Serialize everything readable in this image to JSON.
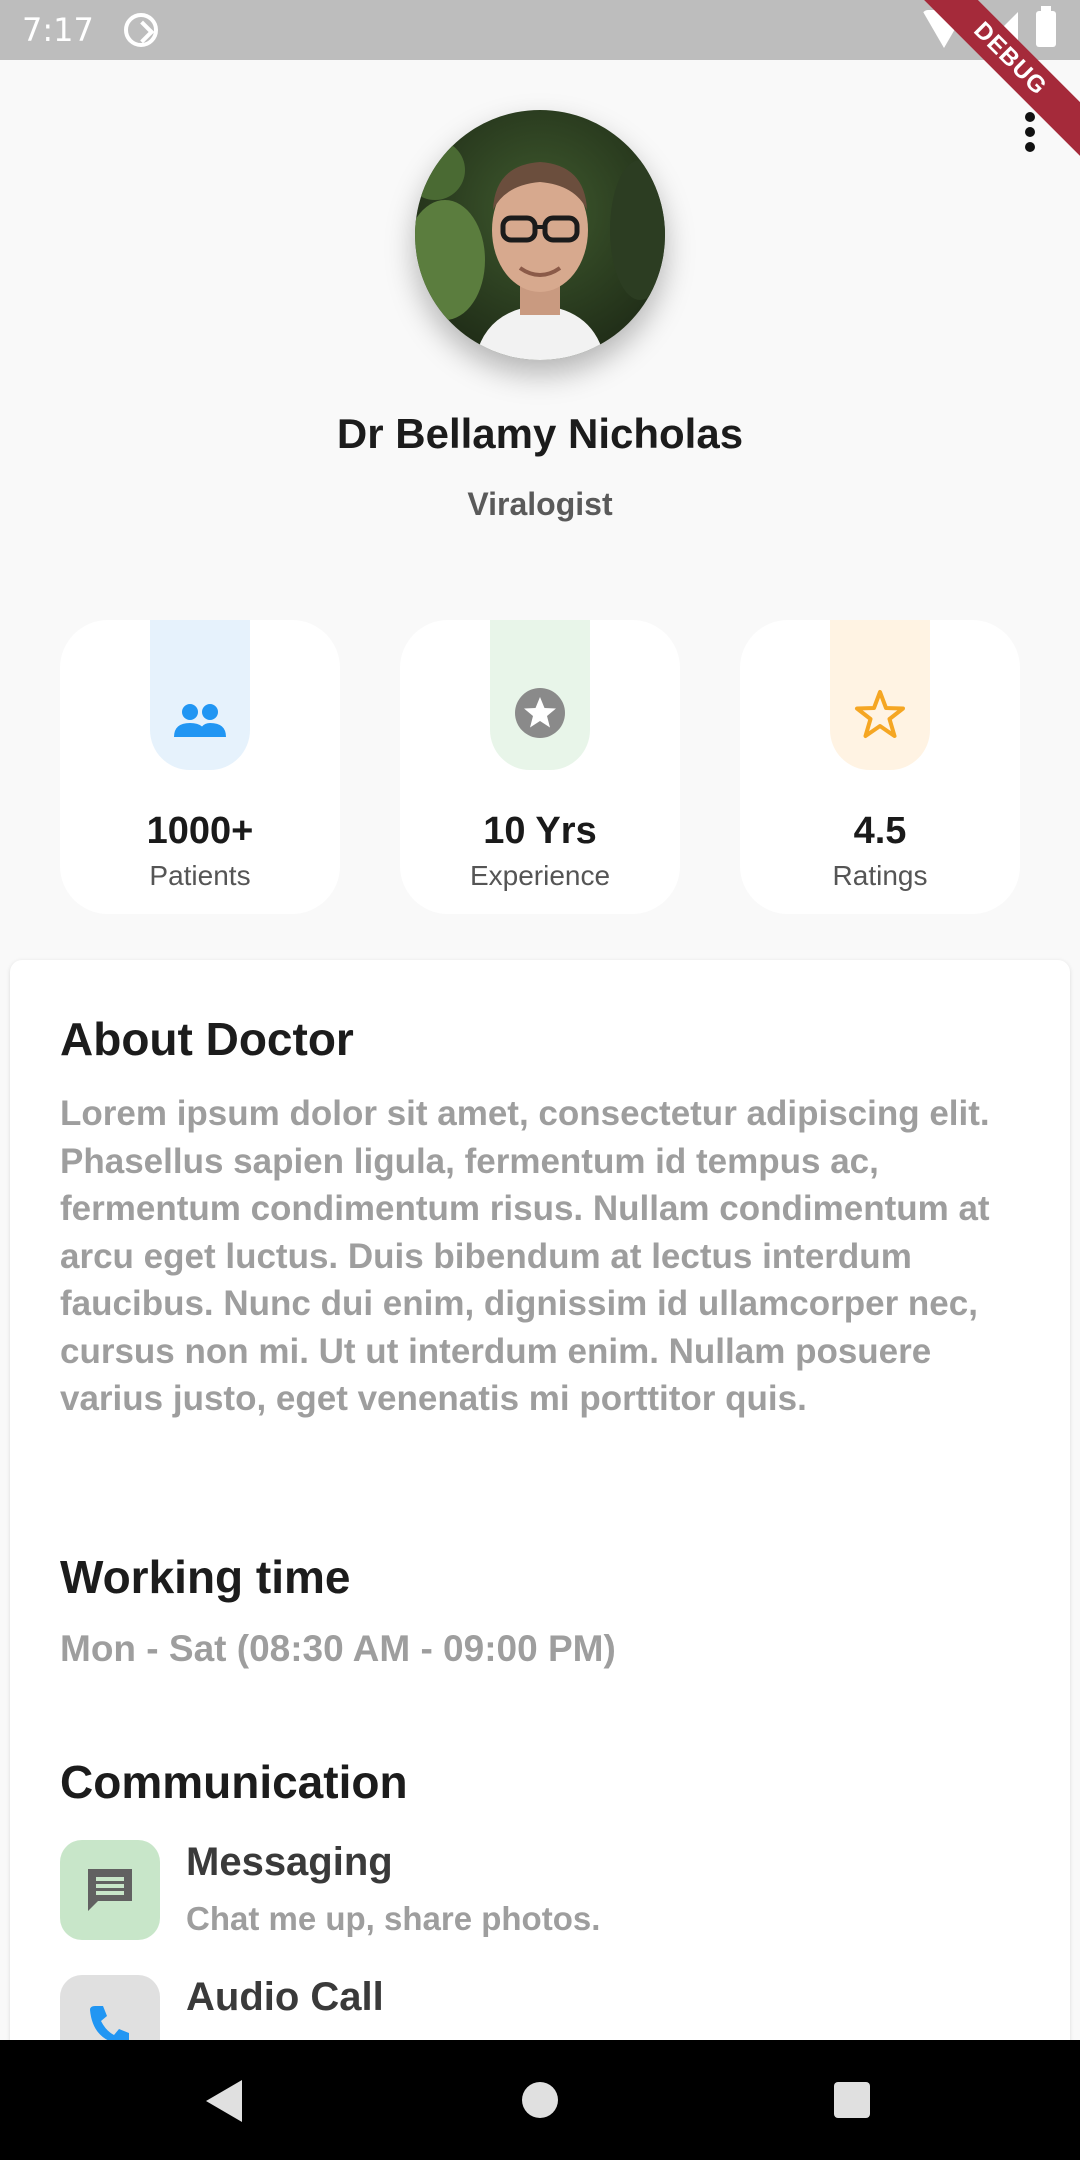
{
  "status_bar": {
    "time": "7:17"
  },
  "debug_label": "DEBUG",
  "doctor": {
    "name": "Dr Bellamy Nicholas",
    "specialty": "Viralogist"
  },
  "stats": [
    {
      "value": "1000+",
      "label": "Patients",
      "icon": "group-icon",
      "tab_color": "#e6f2fc",
      "icon_color": "#2196f3"
    },
    {
      "value": "10 Yrs",
      "label": "Experience",
      "icon": "star-badge-icon",
      "tab_color": "#e8f5e9",
      "icon_color": "#8a8a8a"
    },
    {
      "value": "4.5",
      "label": "Ratings",
      "icon": "star-outline-icon",
      "tab_color": "#fff3e3",
      "icon_color": "#f5a623"
    }
  ],
  "about": {
    "title": "About Doctor",
    "text": "Lorem ipsum dolor sit amet, consectetur adipiscing elit. Phasellus sapien ligula, fermentum id tempus ac, fermentum condimentum risus. Nullam condimentum at arcu eget luctus. Duis bibendum at lectus interdum faucibus. Nunc dui enim, dignissim id ullamcorper nec, cursus non mi. Ut ut interdum enim. Nullam posuere varius justo, eget venenatis mi porttitor quis."
  },
  "working": {
    "title": "Working time",
    "value": "Mon - Sat (08:30 AM - 09:00 PM)"
  },
  "communication": {
    "title": "Communication",
    "items": [
      {
        "title": "Messaging",
        "subtitle": "Chat me up, share photos.",
        "icon": "message-icon",
        "bg": "#c8e6c9"
      },
      {
        "title": "Audio Call",
        "subtitle": "",
        "icon": "phone-icon",
        "bg": "#e0e0e0"
      }
    ]
  }
}
